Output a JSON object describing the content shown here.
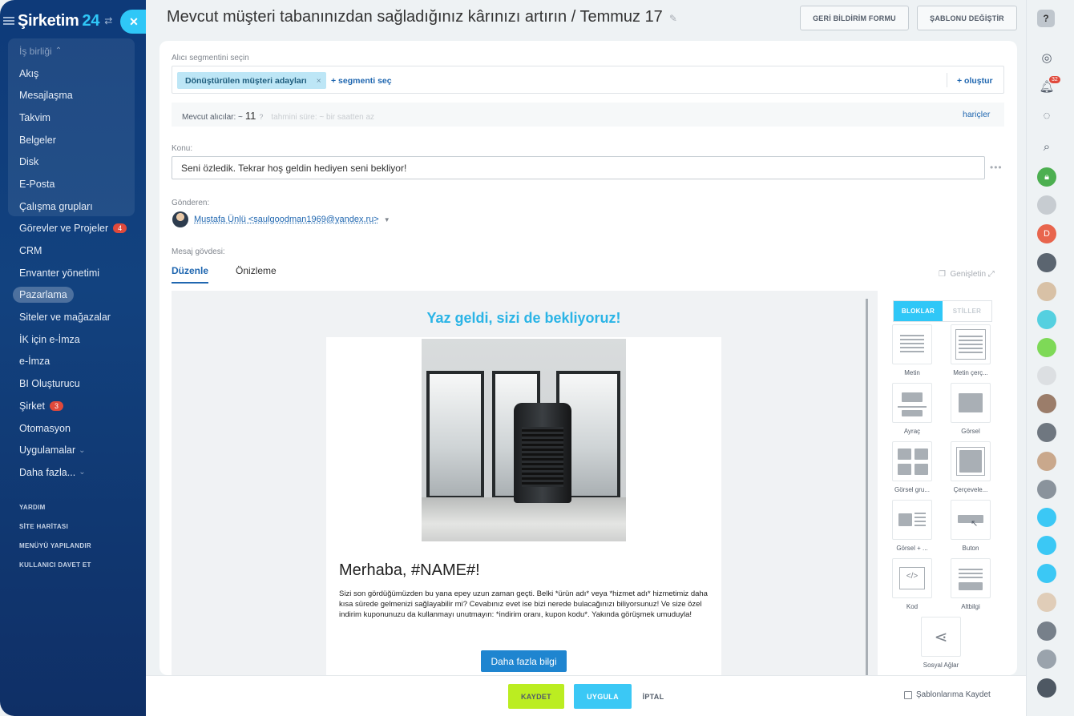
{
  "sidebar": {
    "logo_name": "Şirketim",
    "logo_number": "24",
    "items": [
      {
        "label": "İş birliği"
      },
      {
        "label": "Akış"
      },
      {
        "label": "Mesajlaşma"
      },
      {
        "label": "Takvim"
      },
      {
        "label": "Belgeler"
      },
      {
        "label": "Disk"
      },
      {
        "label": "E-Posta"
      },
      {
        "label": "Çalışma grupları"
      },
      {
        "label": "Görevler ve Projeler",
        "badge": "4"
      },
      {
        "label": "CRM"
      },
      {
        "label": "Envanter yönetimi"
      },
      {
        "label": "Pazarlama"
      },
      {
        "label": "Siteler ve mağazalar"
      },
      {
        "label": "İK için e-İmza"
      },
      {
        "label": "e-İmza"
      },
      {
        "label": "BI Oluşturucu"
      },
      {
        "label": "Şirket",
        "badge": "3"
      },
      {
        "label": "Otomasyon"
      },
      {
        "label": "Uygulamalar"
      },
      {
        "label": "Daha fazla..."
      }
    ],
    "bottom_links": [
      "YARDIM",
      "SİTE HARİTASI",
      "MENÜYÜ YAPILANDIR",
      "KULLANICI DAVET ET"
    ]
  },
  "header": {
    "title": "Mevcut müşteri tabanınızdan sağladığınız kârınızı artırın / Temmuz 17",
    "feedback_btn": "GERİ BİLDİRİM FORMU",
    "template_btn": "ŞABLONU DEĞİŞTİR"
  },
  "form": {
    "segment_label": "Alıcı segmentini seçin",
    "segment_chip": "Dönüştürülen müşteri adayları",
    "select_segment": "+ segmenti seç",
    "create": "+ oluştur",
    "recipients_label": "Mevcut alıcılar: ~",
    "recipients_count": "11",
    "estimate": "tahmini süre: ~ bir saatten az",
    "exclusions": "hariçler",
    "subject_label": "Konu:",
    "subject_value": "Seni özledik. Tekrar hoş geldin hediyen seni bekliyor!",
    "sender_label": "Gönderen:",
    "sender_value": "Mustafa Ünlü <saulgoodman1969@yandex.ru>",
    "body_label": "Mesaj gövdesi:",
    "tab_edit": "Düzenle",
    "tab_preview": "Önizleme",
    "expand": "Genişletin"
  },
  "email": {
    "banner": "Yaz geldi, sizi de bekliyoruz!",
    "greeting": "Merhaba, #NAME#!",
    "body": "Sizi son gördüğümüzden bu yana epey uzun zaman geçti. Belki *ürün adı* veya *hizmet adı* hizmetimiz daha kısa sürede gelmenizi sağlayabilir mi? Cevabınız evet ise bizi nerede bulacağınızı biliyorsunuz! Ve size özel indirim kuponunuzu da kullanmayı unutmayın: *indirim oranı, kupon kodu*. Yakında görüşmek umuduyla!",
    "cta": "Daha fazla bilgi"
  },
  "blocks_panel": {
    "tab_blocks": "BLOKLAR",
    "tab_styles": "STİLLER",
    "blocks": [
      "Metin",
      "Metin çerç...",
      "Ayraç",
      "Görsel",
      "Görsel gru...",
      "Çerçevele...",
      "Görsel + ...",
      "Buton",
      "Kod",
      "Altbilgi",
      "Sosyal Ağlar"
    ]
  },
  "footer": {
    "save": "KAYDET",
    "apply": "UYGULA",
    "cancel": "İPTAL",
    "save_template": "Şablonlarıma Kaydet"
  },
  "rightbar": {
    "notifications_badge": "32",
    "avatar_letter": "D"
  },
  "colors": {
    "accent": "#2fc7f7",
    "save_btn": "#bbed21",
    "link": "#2067b0",
    "banner": "#2ab4e6",
    "cta": "#1f85d0"
  }
}
